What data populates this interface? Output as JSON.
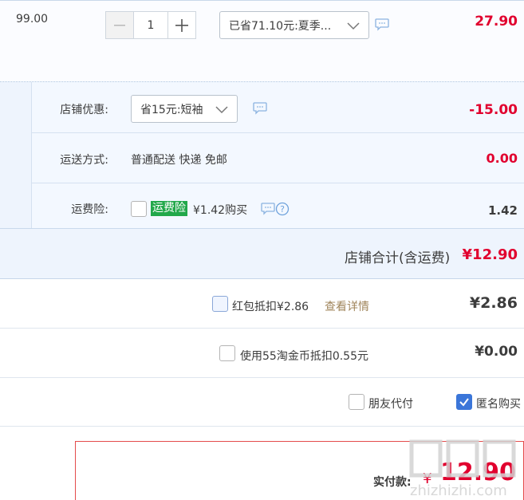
{
  "item": {
    "unit_price": "99.00",
    "quantity": "1",
    "promo_select": "已省71.10元:夏季...",
    "subtotal": "27.90"
  },
  "shop": {
    "discount_label": "店铺优惠:",
    "discount_select": "省15元:短袖",
    "discount_amount": "-15.00",
    "shipping_label": "运送方式:",
    "shipping_value": "普通配送 快递 免邮",
    "shipping_amount": "0.00",
    "insurance_label": "运费险:",
    "insurance_tag": "运费险",
    "insurance_text": "¥1.42购买",
    "insurance_amount": "1.42",
    "total_label": "店铺合计(含运费)",
    "total_amount": "¥12.90"
  },
  "redpacket": {
    "label": "红包抵扣¥2.86",
    "link": "查看详情",
    "amount": "¥2.86"
  },
  "taojinbi": {
    "label": "使用55淘金币抵扣0.55元",
    "amount": "¥0.00"
  },
  "options": {
    "friend_pay": "朋友代付",
    "anonymous": "匿名购买"
  },
  "payment": {
    "label": "实付款:",
    "currency": "¥",
    "amount": "12.90"
  },
  "watermark": {
    "text": "zhizhizhi.com"
  },
  "colors": {
    "price_red": "#e1002e",
    "shop_bg": "#eef4fd",
    "insurance_green": "#22a84a",
    "checkbox_blue": "#3b76d9"
  }
}
